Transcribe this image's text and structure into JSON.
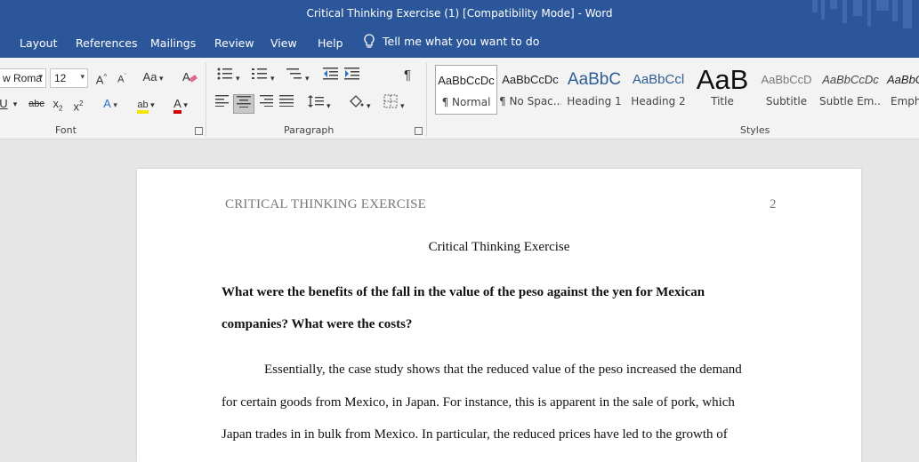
{
  "window": {
    "title": "Critical Thinking Exercise (1) [Compatibility Mode]  -  Word"
  },
  "menu": {
    "tabs": [
      "Layout",
      "References",
      "Mailings",
      "Review",
      "View",
      "Help"
    ],
    "tell_me": "Tell me what you want to do"
  },
  "font_group": {
    "font_name": "w Roma",
    "font_size": "12",
    "change_case": "Aa",
    "label": "Font"
  },
  "paragraph_group": {
    "label": "Paragraph"
  },
  "styles_group": {
    "label": "Styles",
    "items": [
      {
        "preview": "AaBbCcDc",
        "name": "¶ Normal"
      },
      {
        "preview": "AaBbCcDc",
        "name": "¶ No Spac..."
      },
      {
        "preview": "AaBbC",
        "name": "Heading 1"
      },
      {
        "preview": "AaBbCcl",
        "name": "Heading 2"
      },
      {
        "preview": "AaB",
        "name": "Title"
      },
      {
        "preview": "AaBbCcD",
        "name": "Subtitle"
      },
      {
        "preview": "AaBbCcDc",
        "name": "Subtle Em..."
      },
      {
        "preview": "AaBbCc",
        "name": "Emph"
      }
    ]
  },
  "document": {
    "header_left": "CRITICAL THINKING EXERCISE",
    "page_number": "2",
    "title": "Critical Thinking Exercise",
    "question_line1": "What were the benefits of the fall in the value of the peso against the yen for Mexican",
    "question_line2": "companies? What were the costs?",
    "para_line1": "Essentially, the case study shows that the reduced value of the peso increased the demand",
    "para_line2": "for certain goods from Mexico, in Japan. For instance, this is apparent in the sale of pork, which",
    "para_line3": "Japan trades in in bulk from Mexico. In particular, the reduced prices have led to the growth of"
  },
  "colors": {
    "accent": "#2b579a",
    "ribbon": "#f3f3f3",
    "canvas": "#e6e6e6"
  }
}
